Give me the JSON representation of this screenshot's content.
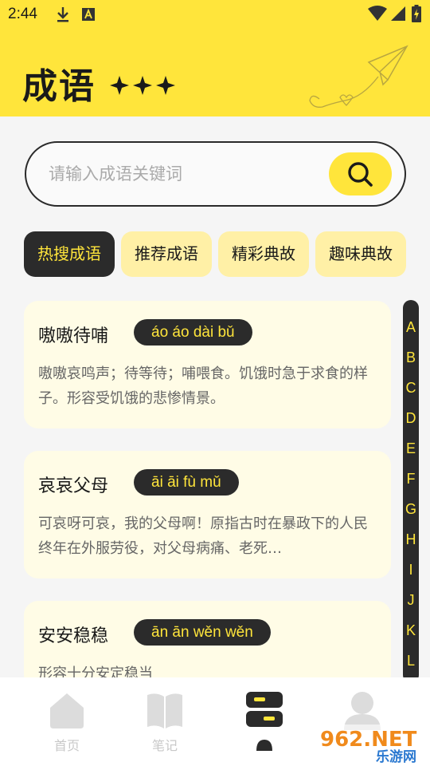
{
  "status_bar": {
    "time": "2:44"
  },
  "header": {
    "title": "成语"
  },
  "search": {
    "placeholder": "请输入成语关键词"
  },
  "tabs": [
    {
      "label": "热搜成语",
      "active": true
    },
    {
      "label": "推荐成语",
      "active": false
    },
    {
      "label": "精彩典故",
      "active": false
    },
    {
      "label": "趣味典故",
      "active": false
    }
  ],
  "idioms": [
    {
      "word": "嗷嗷待哺",
      "pinyin": "áo áo dài bǔ",
      "description": "嗷嗷哀鸣声；待等待；哺喂食。饥饿时急于求食的样子。形容受饥饿的悲惨情景。"
    },
    {
      "word": "哀哀父母",
      "pinyin": "āi āi fù mǔ",
      "description": "可哀呀可哀，我的父母啊！原指古时在暴政下的人民终年在外服劳役，对父母病痛、老死…"
    },
    {
      "word": "安安稳稳",
      "pinyin": "ān ān wěn wěn",
      "description": "形容十分安定稳当"
    }
  ],
  "alphabet": [
    "A",
    "B",
    "C",
    "D",
    "E",
    "F",
    "G",
    "H",
    "I",
    "J",
    "K",
    "L"
  ],
  "bottom_nav": [
    {
      "label": "首页",
      "icon": "home-icon"
    },
    {
      "label": "笔记",
      "icon": "book-icon"
    },
    {
      "label": "",
      "icon": "list-icon"
    },
    {
      "label": "",
      "icon": "user-icon"
    }
  ],
  "watermark": {
    "text_top": "962.NET",
    "text_bottom": "乐游网"
  },
  "colors": {
    "accent": "#ffe53b",
    "dark": "#2b2b2b",
    "card": "#fffce6",
    "tab": "#fff0a6"
  }
}
